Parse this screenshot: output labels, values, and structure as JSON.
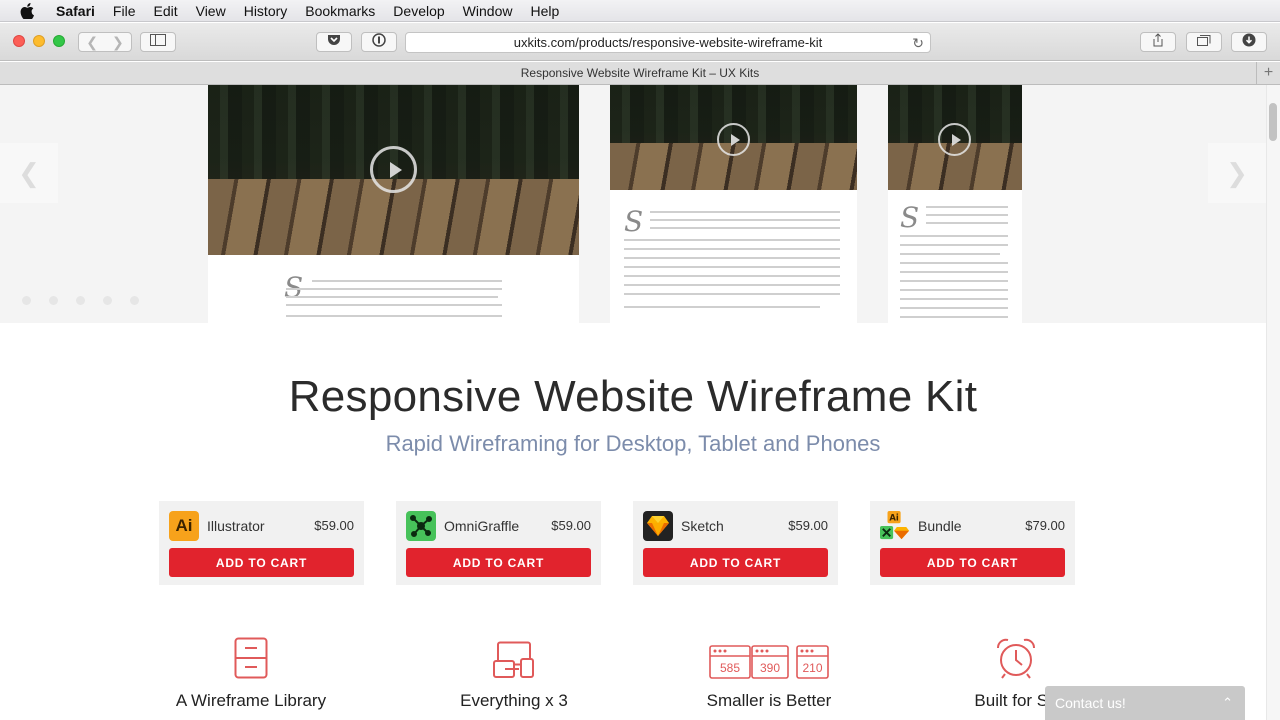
{
  "menubar": {
    "app": "Safari",
    "items": [
      "File",
      "Edit",
      "View",
      "History",
      "Bookmarks",
      "Develop",
      "Window",
      "Help"
    ]
  },
  "browser": {
    "url": "uxkits.com/products/responsive-website-wireframe-kit",
    "tab_title": "Responsive Website Wireframe Kit – UX Kits"
  },
  "hero": {
    "placeholder_letter": "S"
  },
  "page": {
    "title": "Responsive Website Wireframe Kit",
    "subtitle": "Rapid Wireframing for Desktop, Tablet and Phones"
  },
  "products": [
    {
      "name": "Illustrator",
      "price": "$59.00",
      "button": "ADD TO CART",
      "icon": "illustrator-icon",
      "icon_text": "Ai",
      "color": "#f7a21b"
    },
    {
      "name": "OmniGraffle",
      "price": "$59.00",
      "button": "ADD TO CART",
      "icon": "omnigraffle-icon",
      "color": "#47c25a"
    },
    {
      "name": "Sketch",
      "price": "$59.00",
      "button": "ADD TO CART",
      "icon": "sketch-icon",
      "color": "#fdb300"
    },
    {
      "name": "Bundle",
      "price": "$79.00",
      "button": "ADD TO CART",
      "icon": "bundle-icon",
      "icon_text": "Ai",
      "color": "#f7a21b"
    }
  ],
  "features": [
    {
      "label": "A Wireframe Library",
      "icon": "library-cabinet-icon"
    },
    {
      "label": "Everything x 3",
      "icon": "devices-icon"
    },
    {
      "label": "Smaller is Better",
      "icon": "file-sizes-icon",
      "numbers": [
        "585",
        "390",
        "210"
      ]
    },
    {
      "label": "Built for Sp",
      "icon": "alarm-clock-icon"
    }
  ],
  "contact": {
    "label": "Contact us!"
  },
  "colors": {
    "accent": "#e1232d",
    "subtitle": "#7c8cab",
    "icon_stroke": "#e05a5a"
  }
}
